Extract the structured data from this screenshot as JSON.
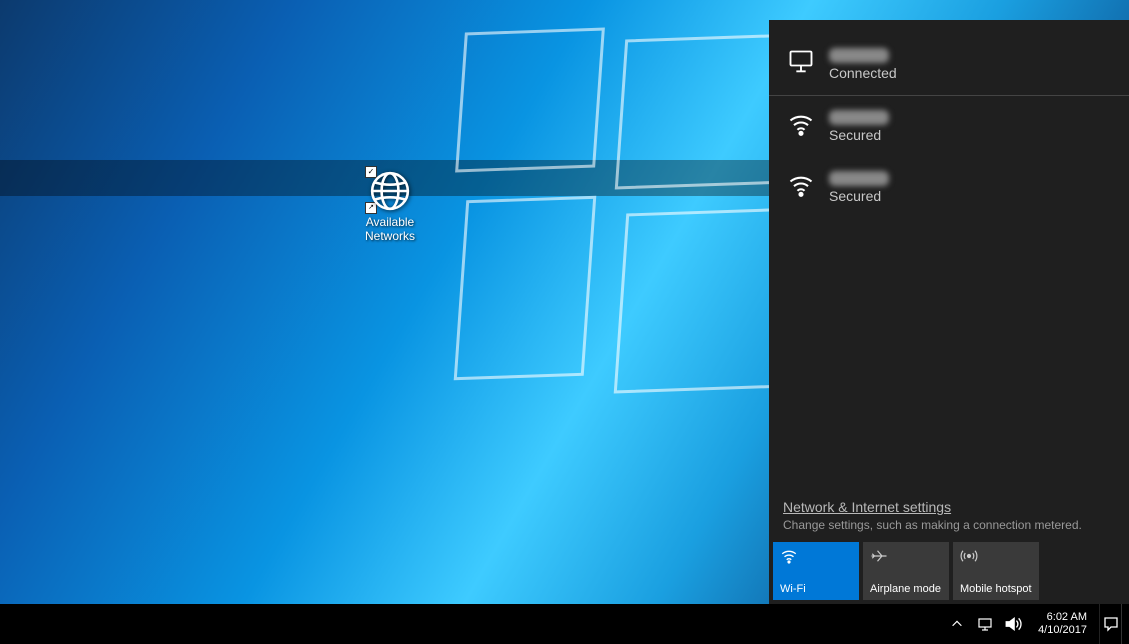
{
  "desktop": {
    "icon": {
      "line1": "Available",
      "line2": "Networks"
    }
  },
  "flyout": {
    "networks": [
      {
        "status": "Connected",
        "type": "ethernet"
      },
      {
        "status": "Secured",
        "type": "wifi"
      },
      {
        "status": "Secured",
        "type": "wifi"
      }
    ],
    "settings": {
      "link": "Network & Internet settings",
      "desc": "Change settings, such as making a connection metered."
    },
    "quick_actions": {
      "wifi": "Wi-Fi",
      "airplane": "Airplane mode",
      "hotspot": "Mobile hotspot"
    }
  },
  "taskbar": {
    "time": "6:02 AM",
    "date": "4/10/2017"
  }
}
